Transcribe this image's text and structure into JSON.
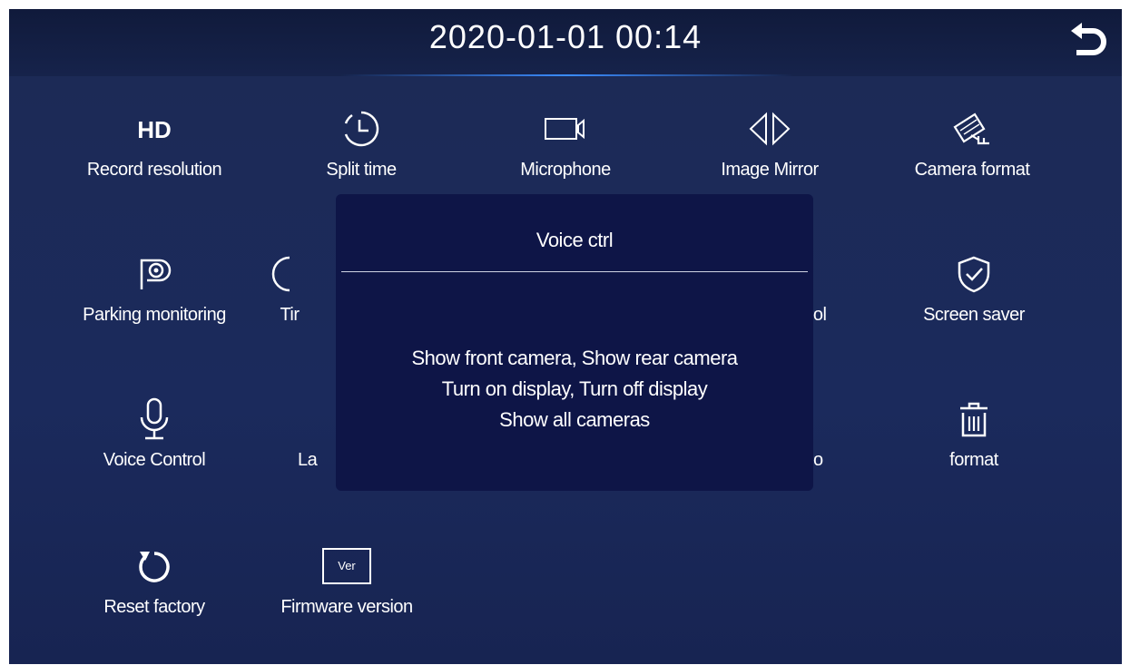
{
  "header": {
    "datetime": "2020-01-01  00:14"
  },
  "menu": [
    {
      "label": "Record resolution",
      "icon": "hd-icon",
      "hd_text": "HD"
    },
    {
      "label": "Split time",
      "icon": "clock-icon"
    },
    {
      "label": "Microphone",
      "icon": "microphone-camera-icon"
    },
    {
      "label": "Image Mirror",
      "icon": "mirror-icon"
    },
    {
      "label": "Camera format",
      "icon": "cctv-camera-icon"
    },
    {
      "label": "Parking monitoring",
      "icon": "parking-icon"
    },
    {
      "label": "Tir",
      "icon": "partial-icon"
    },
    {
      "label": "ntrol",
      "icon": ""
    },
    {
      "label": "Screen saver",
      "icon": "shield-check-icon"
    },
    {
      "label": "Voice Control",
      "icon": "voice-mic-icon"
    },
    {
      "label": "La",
      "icon": ""
    },
    {
      "label": "o",
      "icon": ""
    },
    {
      "label": "format",
      "icon": "trash-icon"
    },
    {
      "label": "Reset factory",
      "icon": "reset-icon"
    },
    {
      "label": "Firmware version",
      "icon": "version-icon",
      "ver_text": "Ver"
    }
  ],
  "dialog": {
    "title": "Voice ctrl",
    "lines": [
      "Show front camera, Show rear camera",
      "Turn on display, Turn off display",
      "Show all cameras"
    ]
  },
  "colors": {
    "background": "#1b2a5c",
    "header": "#121d42",
    "dialog": "#0e1547",
    "accent": "#3b8cff"
  }
}
